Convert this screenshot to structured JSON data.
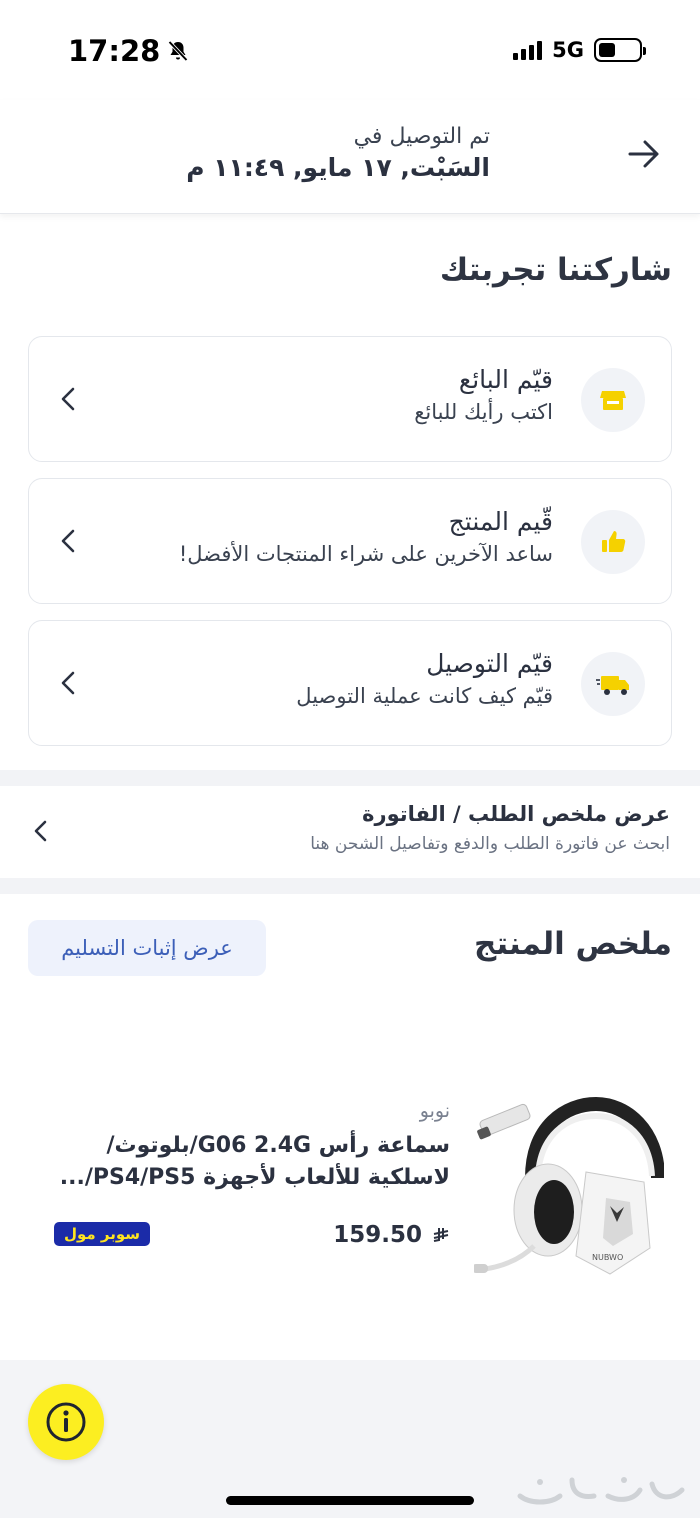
{
  "status_bar": {
    "time": "17:28",
    "network": "5G"
  },
  "header": {
    "subtitle": "تم التوصيل في",
    "date": "السَبْت, ١٧ مايو, ١١:٤٩ م"
  },
  "experience": {
    "title": "شاركتنا تجربتك",
    "cards": [
      {
        "icon": "store-icon",
        "title": "قيّم البائع",
        "subtitle": "اكتب رأيك للبائع"
      },
      {
        "icon": "thumbs-up-icon",
        "title": "قّيم المنتج",
        "subtitle": "ساعد الآخرين على شراء المنتجات الأفضل!"
      },
      {
        "icon": "delivery-truck-icon",
        "title": "قيّم التوصيل",
        "subtitle": "قيّم كيف كانت عملية التوصيل"
      }
    ]
  },
  "invoice": {
    "title": "عرض ملخص الطلب / الفاتورة",
    "subtitle": "ابحث عن فاتورة الطلب والدفع وتفاصيل الشحن هنا"
  },
  "product_summary": {
    "title": "ملخص المنتج",
    "proof_button": "عرض إثبات التسليم",
    "item": {
      "brand": "نوبو",
      "name": "سماعة رأس G06 2.4G/بلوتوث/لاسلكية للألعاب لأجهزة PS4/PS5/...",
      "price": "159.50",
      "badge": "سوبر مول"
    }
  },
  "colors": {
    "accent_yellow": "#fcee21",
    "badge_blue": "#1b2ba8",
    "button_text_blue": "#3c5fb8"
  }
}
